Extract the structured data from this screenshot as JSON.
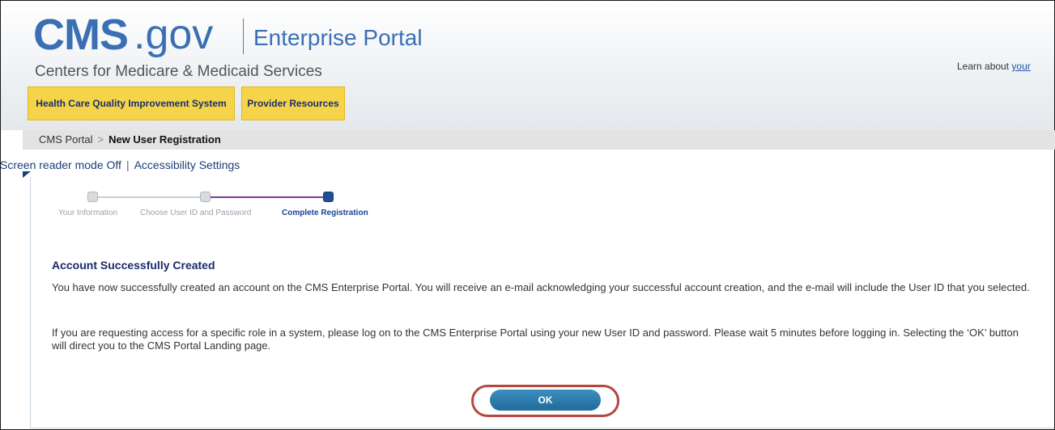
{
  "header": {
    "logo_cms": "CMS",
    "logo_gov": ".gov",
    "logo_portal": "Enterprise Portal",
    "logo_subtitle": "Centers for Medicare & Medicaid Services",
    "learn_prefix": "Learn about",
    "learn_link": "your"
  },
  "nav": {
    "tabs": [
      {
        "label": "Health Care Quality Improvement System"
      },
      {
        "label": "Provider Resources"
      }
    ]
  },
  "breadcrumb": {
    "root": "CMS Portal",
    "separator": ">",
    "current": "New User Registration"
  },
  "accessibility": {
    "screen_reader": "Screen reader mode Off",
    "separator": "|",
    "settings": "Accessibility Settings"
  },
  "steps": [
    {
      "label": "Your Information",
      "state": "completed"
    },
    {
      "label": "Choose User ID and Password",
      "state": "completed"
    },
    {
      "label": "Complete Registration",
      "state": "current"
    }
  ],
  "main": {
    "heading": "Account Successfully Created",
    "paragraph1": "You have now successfully created an account on the CMS Enterprise Portal. You will receive an e-mail acknowledging your successful account creation, and the e-mail will include the User ID that you selected.",
    "paragraph2": "If you are requesting access for a specific role in a system, please log on to the CMS Enterprise Portal using your new User ID and password. Please wait 5 minutes before logging in. Selecting the ‘OK’ button will direct you to the CMS Portal Landing page.",
    "ok_label": "OK"
  },
  "colors": {
    "brand_blue": "#3b6fb3",
    "nav_yellow": "#f5d44a",
    "step_active": "#1a3f9c",
    "highlight_ring": "#b5473f"
  }
}
